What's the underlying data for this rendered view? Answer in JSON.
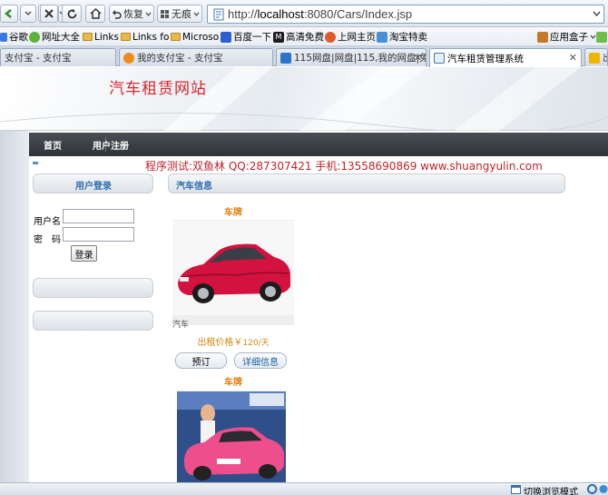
{
  "browser": {
    "back_label": "",
    "restore_label": "恢复",
    "noshadow_label": "无痕",
    "url_prefix": "http://",
    "url_host": "localhost",
    "url_rest": ":8080/Cars/Index.jsp"
  },
  "bookmarks": [
    {
      "label": "谷歌"
    },
    {
      "label": "网址大全"
    },
    {
      "label": "Links"
    },
    {
      "label": "Links fo"
    },
    {
      "label": "Microso"
    },
    {
      "label": "百度一下"
    },
    {
      "label": "高清免费"
    },
    {
      "label": "上网主页"
    },
    {
      "label": "淘宝特卖"
    },
    {
      "label": "应用盒子"
    }
  ],
  "tabs": [
    {
      "label": "支付宝 - 支付宝"
    },
    {
      "label": "我的支付宝 - 支付宝"
    },
    {
      "label": "115网盘|网盘|115,我的网盘|免..."
    },
    {
      "label": "汽车租赁管理系统"
    },
    {
      "label": "出"
    }
  ],
  "site": {
    "title": "汽车租赁网站",
    "nav": {
      "home": "首页",
      "register": "用户注册"
    },
    "marquee": "程序测试:双鱼林 QQ:287307421 手机:13558690869 www.shuangyulin.com"
  },
  "login": {
    "header": "用户登录",
    "username_label": "用户名",
    "password_label": "密　码",
    "login_button": "登录"
  },
  "cars": {
    "header": "汽车信息",
    "items": [
      {
        "label": "车牌",
        "caption": "汽车",
        "price": "出租价格￥",
        "price_unit": "120/天",
        "book": "预订",
        "detail": "详细信息"
      },
      {
        "label": "车牌"
      }
    ]
  },
  "status": {
    "mode": "切换浏览模式"
  },
  "colors": {
    "title_red": "#d8262e",
    "price_orange": "#d08a12",
    "label_orange": "#e0800f",
    "link_blue": "#2a6db0",
    "nav_dark": "#2f3338"
  }
}
